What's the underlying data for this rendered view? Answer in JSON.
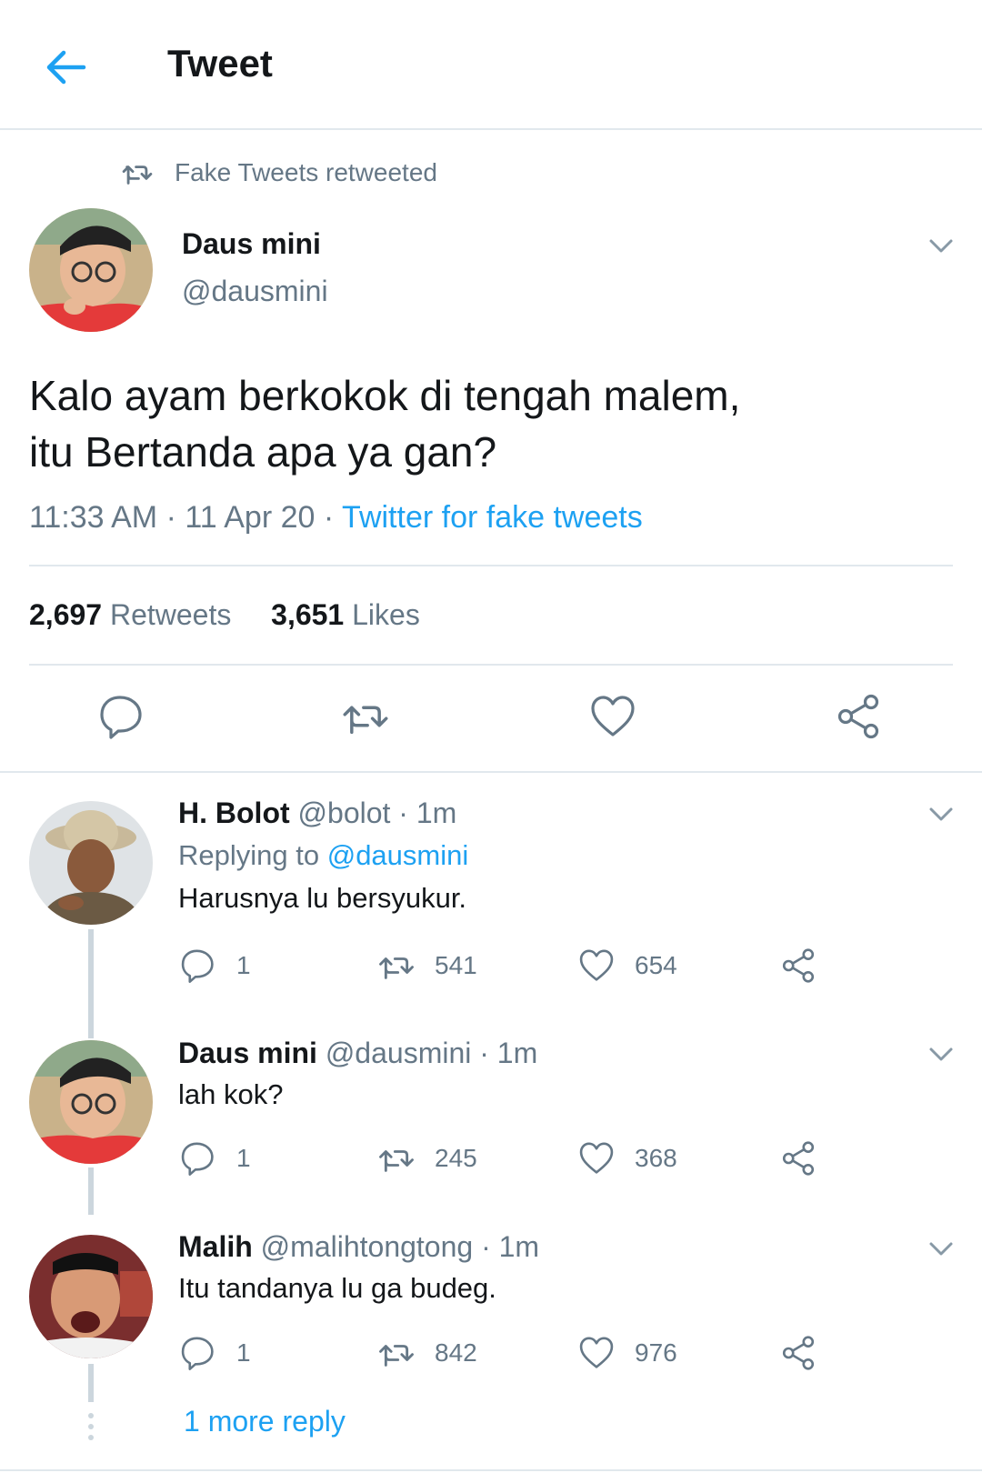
{
  "header": {
    "title": "Tweet",
    "back_icon": "arrow-left-icon"
  },
  "colors": {
    "accent": "#1da1f2",
    "muted": "#657786",
    "text": "#14171a",
    "divider": "#e1e8ed"
  },
  "main_tweet": {
    "retweeted_by": "Fake Tweets retweeted",
    "author_name": "Daus mini",
    "author_handle": "@dausmini",
    "text_line1": "Kalo ayam berkokok di tengah malem,",
    "text_line2": "itu Bertanda apa ya gan?",
    "time": "11:33 AM",
    "date": "11 Apr 20",
    "source": "Twitter for fake tweets",
    "retweets_count": "2,697",
    "retweets_label": "Retweets",
    "likes_count": "3,651",
    "likes_label": "Likes"
  },
  "replies": [
    {
      "name": "H. Bolot",
      "handle": "@bolot",
      "time": "1m",
      "replying_prefix": "Replying to",
      "replying_to": "@dausmini",
      "text": "Harusnya lu bersyukur.",
      "reply_count": "1",
      "retweet_count": "541",
      "like_count": "654"
    },
    {
      "name": "Daus mini",
      "handle": "@dausmini",
      "time": "1m",
      "text": "lah kok?",
      "reply_count": "1",
      "retweet_count": "245",
      "like_count": "368"
    },
    {
      "name": "Malih",
      "handle": "@malihtongtong",
      "time": "1m",
      "text": "Itu tandanya lu ga budeg.",
      "reply_count": "1",
      "retweet_count": "842",
      "like_count": "976"
    }
  ],
  "more_replies": "1 more reply",
  "sep": "·"
}
